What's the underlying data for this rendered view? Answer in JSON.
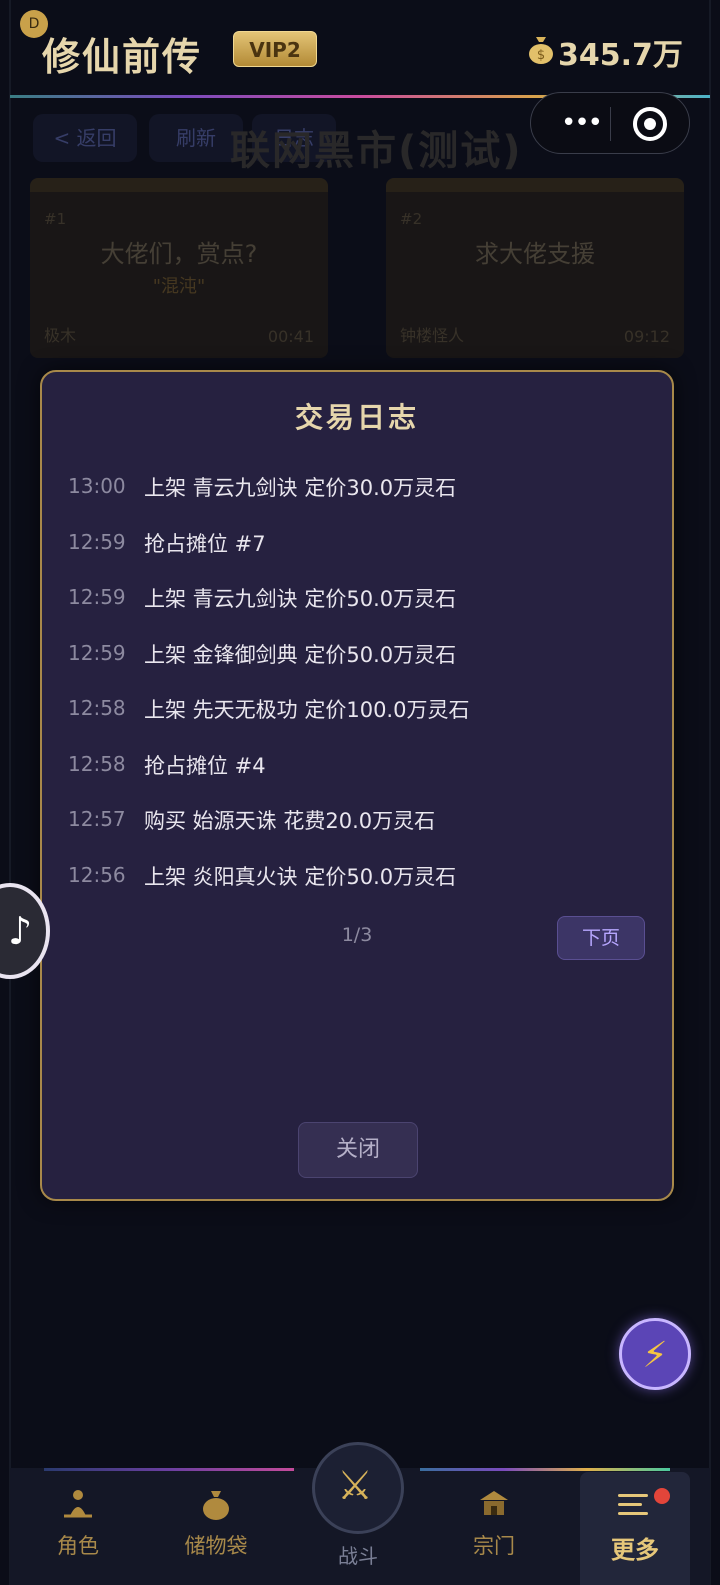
{
  "header": {
    "avatar_letter": "D",
    "title": "修仙前传",
    "vip": "VIP2",
    "money": "345.7万"
  },
  "market": {
    "back_label": "< 返回",
    "refresh_label": "刷新",
    "log_label": "日志",
    "title": "联网黑市(测试)",
    "stalls": [
      {
        "no": "#1",
        "name": "大佬们，赏点?",
        "sub": "\"混沌\"",
        "owner": "极木",
        "time": "00:41"
      },
      {
        "no": "#2",
        "name": "求大佬支援",
        "sub": "",
        "owner": "钟楼怪人",
        "time": "09:12"
      }
    ]
  },
  "modal": {
    "title": "交易日志",
    "entries": [
      {
        "time": "13:00",
        "text": "上架 青云九剑诀 定价30.0万灵石"
      },
      {
        "time": "12:59",
        "text": "抢占摊位 #7"
      },
      {
        "time": "12:59",
        "text": "上架 青云九剑诀 定价50.0万灵石"
      },
      {
        "time": "12:59",
        "text": "上架 金锋御剑典 定价50.0万灵石"
      },
      {
        "time": "12:58",
        "text": "上架 先天无极功 定价100.0万灵石"
      },
      {
        "time": "12:58",
        "text": "抢占摊位 #4"
      },
      {
        "time": "12:57",
        "text": "购买 始源天诛 花费20.0万灵石"
      },
      {
        "time": "12:56",
        "text": "上架 炎阳真火诀 定价50.0万灵石"
      }
    ],
    "page_indicator": "1/3",
    "next_label": "下页",
    "close_label": "关闭"
  },
  "nav": {
    "items": [
      {
        "label": "角色",
        "icon": "meditation-icon"
      },
      {
        "label": "储物袋",
        "icon": "bag-icon"
      },
      {
        "label": "战斗",
        "icon": "crossed-swords-icon"
      },
      {
        "label": "宗门",
        "icon": "temple-icon"
      },
      {
        "label": "更多",
        "icon": "menu-icon"
      }
    ]
  },
  "colors": {
    "gold": "#e6d6ac",
    "modal_bg": "#262140",
    "accent_purple": "#b7a6ff"
  }
}
